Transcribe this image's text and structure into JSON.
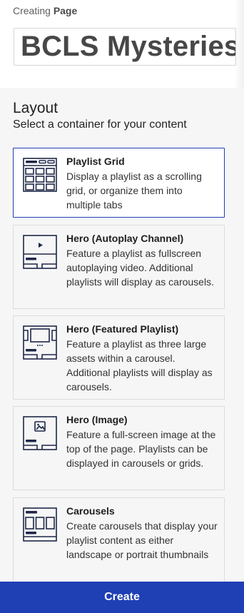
{
  "header": {
    "creating_label": "Creating",
    "creating_type": "Page",
    "page_name": "BCLS Mysteries"
  },
  "layout": {
    "title": "Layout",
    "subtitle": "Select a container for your content",
    "options": [
      {
        "title": "Playlist Grid",
        "description": "Display a playlist as a scrolling grid, or organize them into multiple tabs",
        "icon": "playlist-grid-icon",
        "selected": true
      },
      {
        "title": "Hero (Autoplay Channel)",
        "description": "Feature a playlist as fullscreen autoplaying video. Additional playlists will display as carousels.",
        "icon": "hero-autoplay-icon",
        "selected": false
      },
      {
        "title": "Hero (Featured Playlist)",
        "description": "Feature a playlist as three large assets within a carousel. Additional playlists will display as carousels.",
        "icon": "hero-featured-playlist-icon",
        "selected": false
      },
      {
        "title": "Hero (Image)",
        "description": "Feature a full-screen image at the top of the page. Playlists can be displayed in carousels or grids.",
        "icon": "hero-image-icon",
        "selected": false
      },
      {
        "title": "Carousels",
        "description": "Create carousels that display your playlist content as either landscape or portrait thumbnails",
        "icon": "carousels-icon",
        "selected": false
      }
    ]
  },
  "footer": {
    "create_label": "Create"
  },
  "colors": {
    "accent": "#1f3fb5",
    "icon": "#1e2748"
  }
}
